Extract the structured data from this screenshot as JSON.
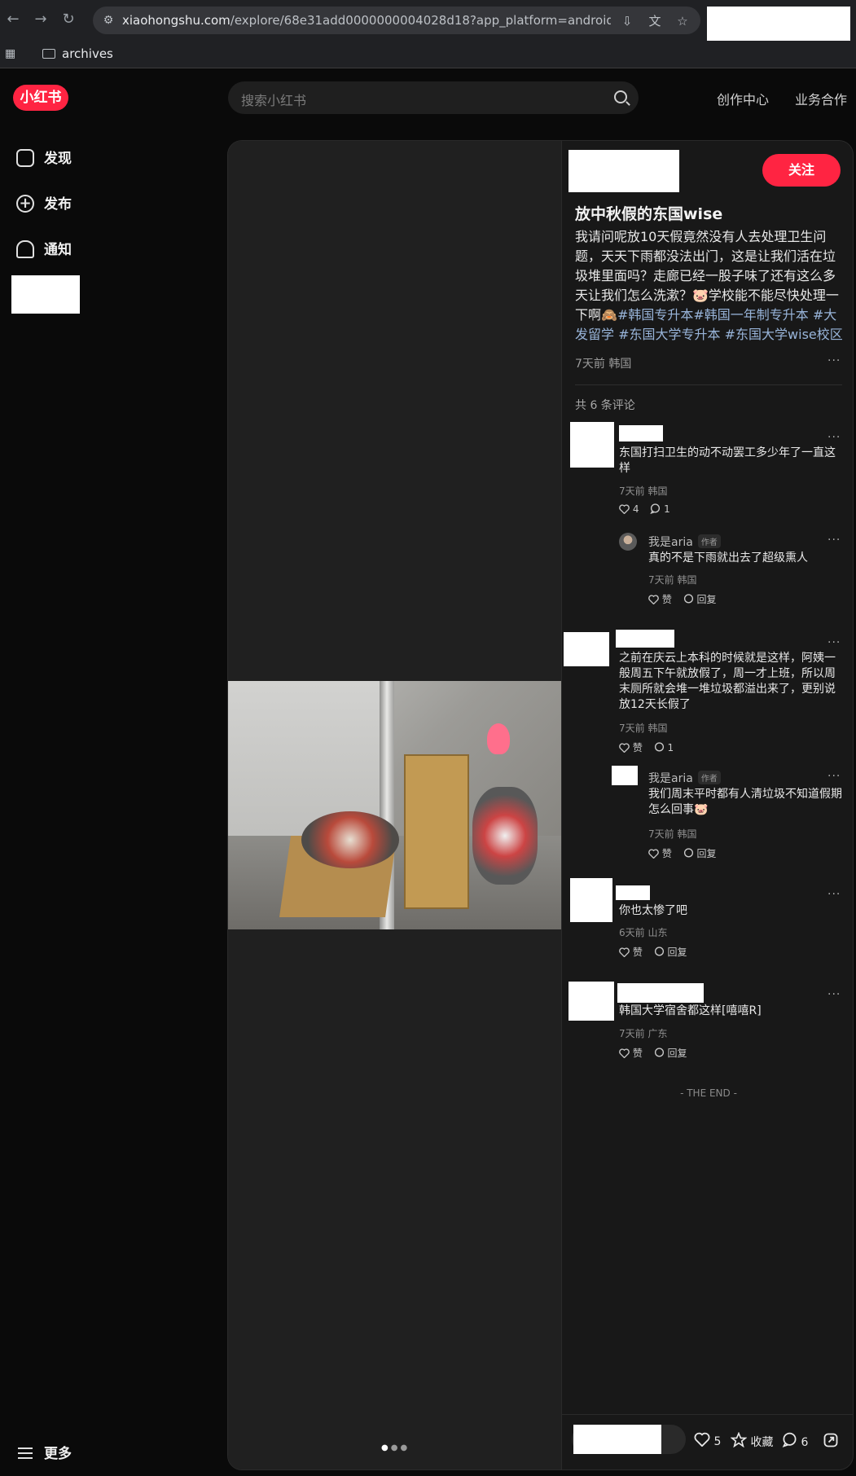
{
  "browser": {
    "url_host": "xiaohongshu.com",
    "url_path": "/explore/68e31add0000000004028d18?app_platform=android&ignoreEnga...",
    "bookmark_folder": "archives"
  },
  "header": {
    "logo": "小红书",
    "search_placeholder": "搜索小红书",
    "links": [
      "创作中心",
      "业务合作"
    ]
  },
  "sidebar": {
    "items": [
      {
        "label": "发现",
        "icon": "home-icon"
      },
      {
        "label": "发布",
        "icon": "plus-icon"
      },
      {
        "label": "通知",
        "icon": "bell-icon"
      }
    ],
    "more": "更多"
  },
  "note": {
    "follow": "关注",
    "title": "放中秋假的东国wise",
    "desc_text": "我请问呢放10天假竟然没有人去处理卫生问题，天天下雨都没法出门，这是让我们活在垃圾堆里面吗？走廊已经一股子味了还有这么多天让我们怎么洗漱？🐷学校能不能尽快处理一下啊🙈",
    "tags": [
      "#韩国专升本",
      "#韩国一年制专升本",
      "#大发留学",
      "#东国大学专升本",
      "#东国大学wise校区"
    ],
    "meta": "7天前 韩国",
    "comment_count": "共 6 条评论",
    "end": "- THE END -",
    "carousel": "• • •"
  },
  "comments": [
    {
      "text": "东国打扫卫生的动不动罢工多少年了一直这样",
      "meta": "7天前 韩国",
      "likes": "4",
      "replies": "1",
      "reply": {
        "name": "我是aria",
        "badge": "作者",
        "text": "真的不是下雨就出去了超级熏人",
        "meta": "7天前 韩国",
        "like_label": "赞",
        "reply_label": "回复"
      }
    },
    {
      "text": "之前在庆云上本科的时候就是这样，阿姨一般周五下午就放假了，周一才上班，所以周末厕所就会堆一堆垃圾都溢出来了，更别说放12天长假了",
      "meta": "7天前 韩国",
      "like_label": "赞",
      "replies": "1",
      "reply": {
        "name": "我是aria",
        "badge": "作者",
        "text": "我们周末平时都有人清垃圾不知道假期怎么回事🐷",
        "meta": "7天前 韩国",
        "like_label": "赞",
        "reply_label": "回复"
      }
    },
    {
      "text": "你也太惨了吧",
      "meta": "6天前 山东",
      "like_label": "赞",
      "reply_label": "回复"
    },
    {
      "text": "韩国大学宿舍都这样[嘻嘻R]",
      "meta": "7天前 广东",
      "like_label": "赞",
      "reply_label": "回复"
    }
  ],
  "bottom": {
    "likes": "5",
    "collect": "收藏",
    "comments": "6"
  },
  "colors": {
    "brand": "#ff2442",
    "tag": "#98b4d9",
    "bg": "#0a0a0a"
  }
}
